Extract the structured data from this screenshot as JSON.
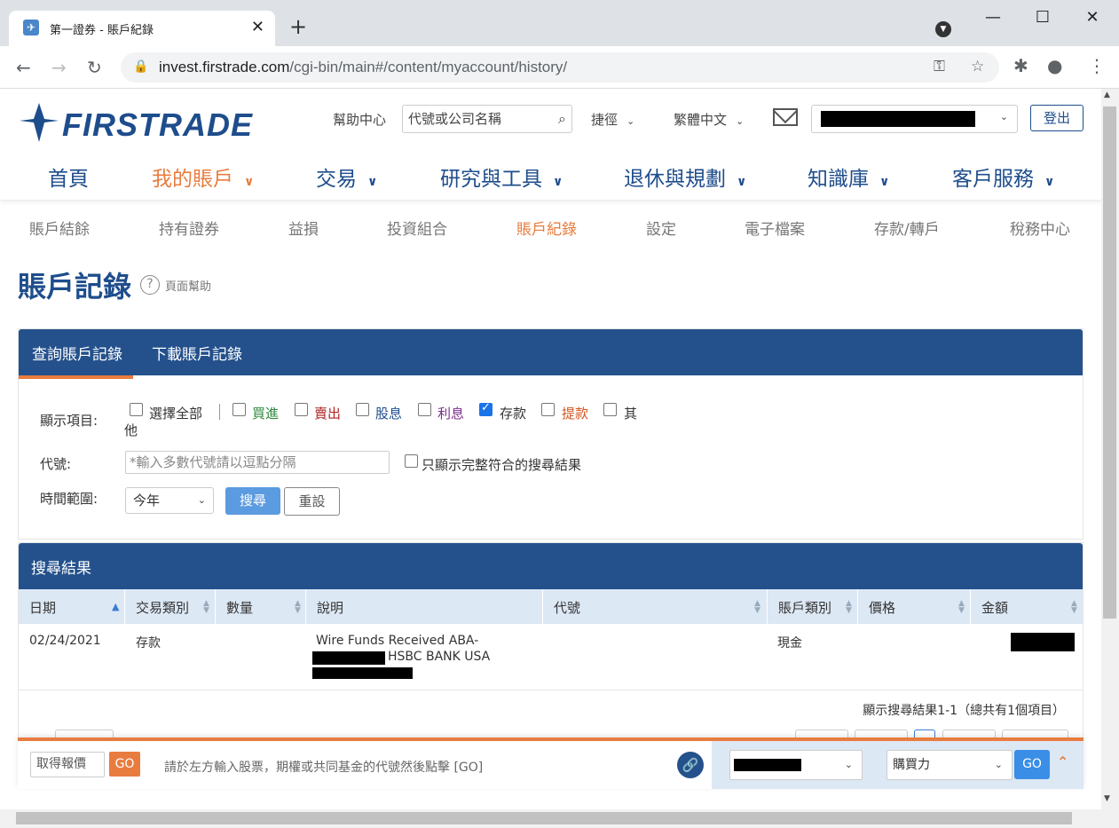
{
  "browser": {
    "tab_title": "第一證券 - 賬戶紀錄",
    "url_host": "invest.firstrade.com",
    "url_path": "/cgi-bin/main#/content/myaccount/history/"
  },
  "header": {
    "logo_text": "FIRSTRADE",
    "help_center": "幫助中心",
    "search_placeholder": "代號或公司名稱",
    "shortcut": "捷徑",
    "language": "繁體中文",
    "logout": "登出"
  },
  "main_nav": [
    {
      "label": "首頁"
    },
    {
      "label": "我的賬戶"
    },
    {
      "label": "交易"
    },
    {
      "label": "研究與工具"
    },
    {
      "label": "退休與規劃"
    },
    {
      "label": "知識庫"
    },
    {
      "label": "客戶服務"
    }
  ],
  "sub_nav": [
    {
      "label": "賬戶結餘"
    },
    {
      "label": "持有證券"
    },
    {
      "label": "益損"
    },
    {
      "label": "投資組合"
    },
    {
      "label": "賬戶紀錄"
    },
    {
      "label": "設定"
    },
    {
      "label": "電子檔案"
    },
    {
      "label": "存款/轉戶"
    },
    {
      "label": "稅務中心"
    }
  ],
  "page": {
    "title": "賬戶記錄",
    "help": "頁面幫助"
  },
  "query_panel": {
    "tabs": [
      {
        "label": "查詢賬戶記錄"
      },
      {
        "label": "下載賬戶記錄"
      }
    ],
    "show_items_label": "顯示項目:",
    "checkboxes": [
      {
        "label": "選擇全部",
        "checked": false,
        "color": "#333333"
      },
      {
        "label": "買進",
        "checked": false,
        "color": "#2e8b3c"
      },
      {
        "label": "賣出",
        "checked": false,
        "color": "#b22222"
      },
      {
        "label": "股息",
        "checked": false,
        "color": "#1e4d8c"
      },
      {
        "label": "利息",
        "checked": false,
        "color": "#7b2d8b"
      },
      {
        "label": "存款",
        "checked": true,
        "color": "#333333"
      },
      {
        "label": "提款",
        "checked": false,
        "color": "#d2541e"
      },
      {
        "label": "其",
        "checked": false,
        "color": "#333333"
      }
    ],
    "other_wrap": "他",
    "symbol_label": "代號:",
    "symbol_placeholder": "*輸入多數代號請以逗點分隔",
    "exact_match_label": "只顯示完整符合的搜尋結果",
    "range_label": "時間範圍:",
    "range_value": "今年",
    "search_btn": "搜尋",
    "reset_btn": "重設"
  },
  "results": {
    "title": "搜尋結果",
    "columns": [
      "日期",
      "交易類別",
      "數量",
      "說明",
      "代號",
      "賬戶類別",
      "價格",
      "金額"
    ],
    "rows": [
      {
        "date": "02/24/2021",
        "type": "存款",
        "desc_line1": "Wire Funds Received ABA-",
        "desc_line2": "HSBC BANK USA",
        "account_type": "現金"
      }
    ],
    "summary": "顯示搜尋結果1-1（總共有1個項目）"
  },
  "bottom_bar": {
    "quote_label": "取得報價",
    "go": "GO",
    "hint": "請於左方輸入股票，期權或共同基金的代號然後點擊 [GO]",
    "buying_power": "購買力"
  },
  "colors": {
    "brand_blue": "#24518c",
    "accent_orange": "#e87c3e"
  }
}
